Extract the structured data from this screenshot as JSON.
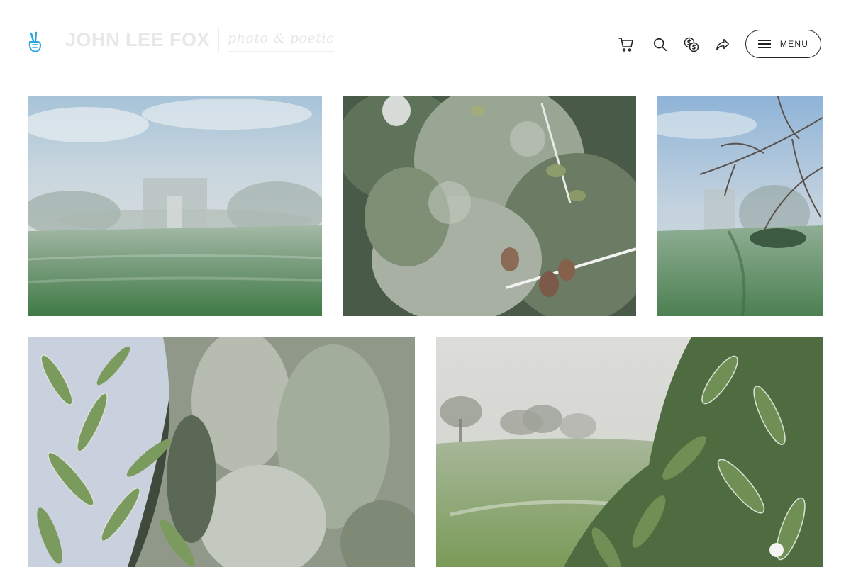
{
  "header": {
    "brand_name": "JOHN LEE FOX",
    "brand_tagline": "photo & poetic",
    "menu_label": "MENU",
    "icons": [
      "peace-hand-icon",
      "cart-icon",
      "search-icon",
      "currency-icon",
      "share-icon",
      "hamburger-icon"
    ]
  },
  "gallery": {
    "photos": [
      {
        "name": "foggy-park-sculpture"
      },
      {
        "name": "frosted-hedge-leaves"
      },
      {
        "name": "frosted-branches-field"
      },
      {
        "name": "frosted-conifer-leaves"
      },
      {
        "name": "foggy-trees-frosted-bush"
      }
    ]
  },
  "colors": {
    "accent": "#29a7e1",
    "text": "#222222",
    "brand_faded": "#e8e8e8",
    "background": "#ffffff"
  }
}
